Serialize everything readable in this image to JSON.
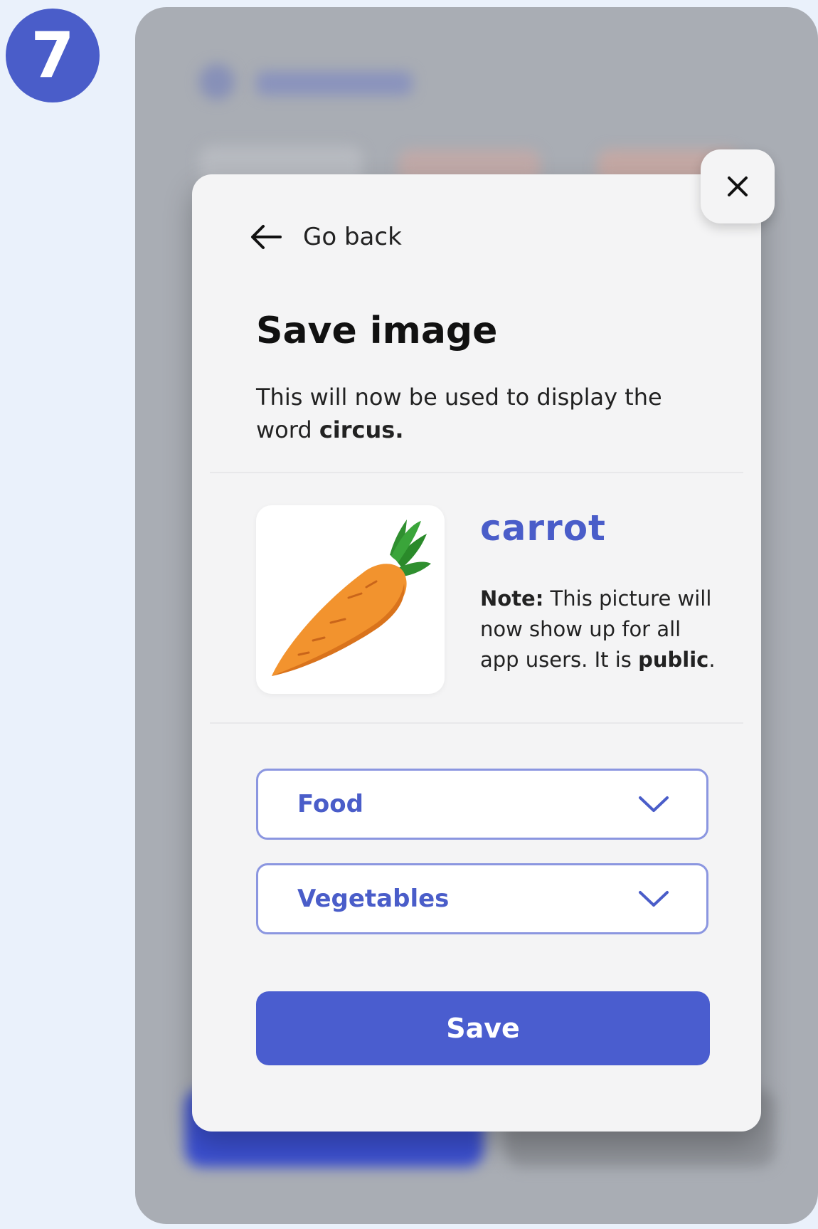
{
  "step": {
    "number": "7"
  },
  "modal": {
    "back_label": "Go back",
    "title": "Save image",
    "description_prefix": "This will now be used to display the word",
    "description_word": "circus.",
    "image_word": "carrot",
    "note_label": "Note:",
    "note_text": "This picture will now show up for all app users. It is",
    "note_emphasis": "public",
    "note_end": ".",
    "category_select": {
      "value": "Food"
    },
    "subcategory_select": {
      "value": "Vegetables"
    },
    "save_label": "Save"
  },
  "colors": {
    "accent": "#4a5dc9",
    "select_border": "#8b96e0",
    "modal_bg": "#f4f4f5",
    "page_bg": "#eaf1fb"
  },
  "icons": {
    "step": "number-badge",
    "back": "arrow-left-icon",
    "close": "close-icon",
    "select": "chevron-down-icon",
    "image": "carrot-illustration"
  }
}
